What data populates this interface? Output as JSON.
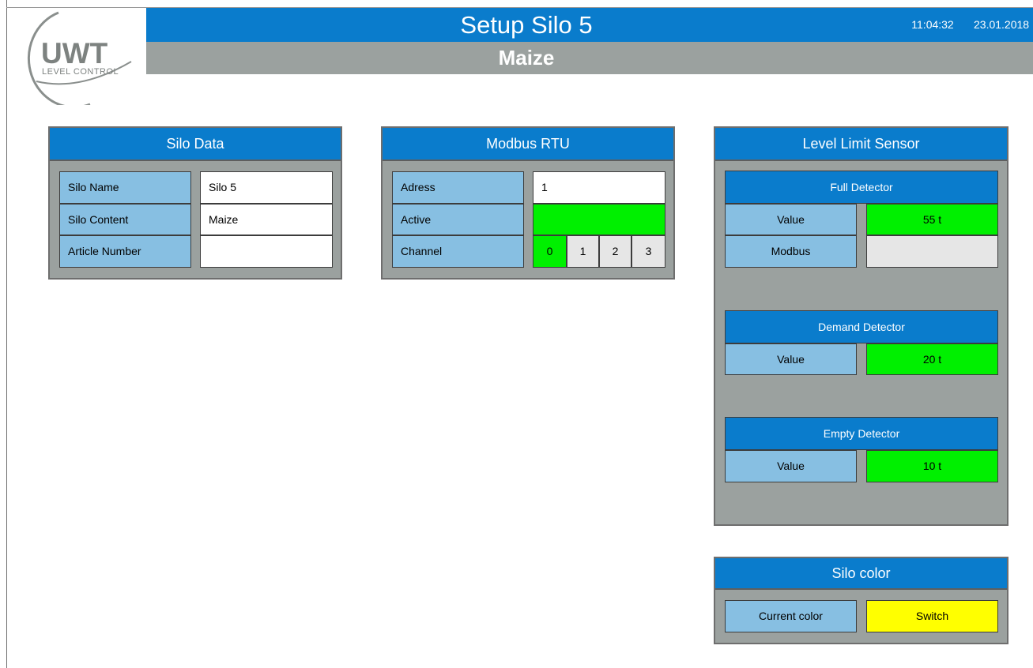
{
  "header": {
    "title": "Setup Silo 5",
    "subtitle": "Maize",
    "time": "11:04:32",
    "date": "23.01.2018"
  },
  "logo": {
    "brand": "UWT",
    "tagline": "LEVEL CONTROL"
  },
  "silo_data": {
    "title": "Silo Data",
    "rows": [
      {
        "label": "Silo Name",
        "value": "Silo 5"
      },
      {
        "label": "Silo Content",
        "value": "Maize"
      },
      {
        "label": "Article Number",
        "value": ""
      }
    ]
  },
  "modbus": {
    "title": "Modbus RTU",
    "address_label": "Adress",
    "address_value": "1",
    "active_label": "Active",
    "channel_label": "Channel",
    "channels": [
      "0",
      "1",
      "2",
      "3"
    ],
    "selected_channel": "0"
  },
  "level_limit": {
    "title": "Level Limit Sensor",
    "full": {
      "title": "Full Detector",
      "value_label": "Value",
      "value": "55  t",
      "modbus_label": "Modbus"
    },
    "demand": {
      "title": "Demand Detector",
      "value_label": "Value",
      "value": "20  t"
    },
    "empty": {
      "title": "Empty Detector",
      "value_label": "Value",
      "value": "10  t"
    }
  },
  "silo_color": {
    "title": "Silo color",
    "label": "Current color",
    "button": "Switch"
  },
  "colors": {
    "header_blue": "#0a7ccc",
    "panel_grey": "#9ba19f",
    "label_blue": "#87bfe2",
    "active_green": "#00f000",
    "switch_yellow": "#ffff00"
  }
}
